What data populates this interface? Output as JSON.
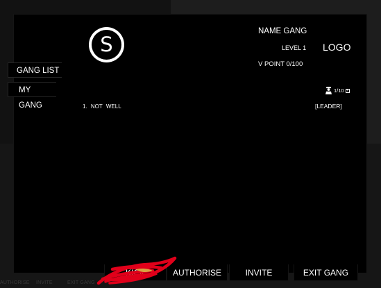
{
  "gang": {
    "name": "NAME GANG",
    "level": "LEVEL 1",
    "points": "V POINT 0/100",
    "logo": "LOGO",
    "avatar_letter": "S",
    "member_count": "1/10"
  },
  "tabs": [
    {
      "label": "GANG LIST"
    },
    {
      "label": "MY GANG"
    }
  ],
  "members": [
    {
      "row": "1. NOT WELL",
      "rank": "[LEADER]"
    }
  ],
  "actions": {
    "kick": "KICK",
    "authorise": "AUTHORISE",
    "invite": "INVITE",
    "exit": "EXIT GANG"
  },
  "background_ghost": {
    "authorise": "AUTHORISE",
    "invite": "INVITE",
    "exit": "EXIT GANG"
  },
  "colors": {
    "panel": "#000000",
    "text": "#ffffff",
    "scribble": "#e0001a"
  },
  "icons": {
    "members": "user-icon",
    "add": "plus-icon"
  }
}
